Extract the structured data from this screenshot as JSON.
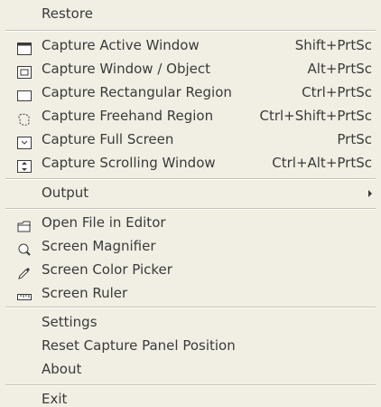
{
  "menu": {
    "restore": "Restore",
    "capture_active_window": {
      "label": "Capture Active Window",
      "shortcut": "Shift+PrtSc",
      "icon": "window-icon"
    },
    "capture_window_object": {
      "label": "Capture Window / Object",
      "shortcut": "Alt+PrtSc",
      "icon": "window-object-icon"
    },
    "capture_rectangular_region": {
      "label": "Capture Rectangular Region",
      "shortcut": "Ctrl+PrtSc",
      "icon": "rectangle-region-icon"
    },
    "capture_freehand_region": {
      "label": "Capture Freehand Region",
      "shortcut": "Ctrl+Shift+PrtSc",
      "icon": "freehand-region-icon"
    },
    "capture_full_screen": {
      "label": "Capture Full Screen",
      "shortcut": "PrtSc",
      "icon": "full-screen-icon"
    },
    "capture_scrolling_window": {
      "label": "Capture Scrolling Window",
      "shortcut": "Ctrl+Alt+PrtSc",
      "icon": "scrolling-window-icon"
    },
    "output": "Output",
    "open_file_in_editor": {
      "label": "Open File in Editor",
      "icon": "open-file-icon"
    },
    "screen_magnifier": {
      "label": "Screen Magnifier",
      "icon": "magnifier-icon"
    },
    "screen_color_picker": {
      "label": "Screen Color Picker",
      "icon": "color-picker-icon"
    },
    "screen_ruler": {
      "label": "Screen Ruler",
      "icon": "ruler-icon"
    },
    "settings": "Settings",
    "reset_capture_panel_position": "Reset Capture Panel Position",
    "about": "About",
    "exit": "Exit"
  },
  "colors": {
    "background": "#f1efe4",
    "text": "#3a3a3a",
    "separator": "#c6c2b4"
  }
}
